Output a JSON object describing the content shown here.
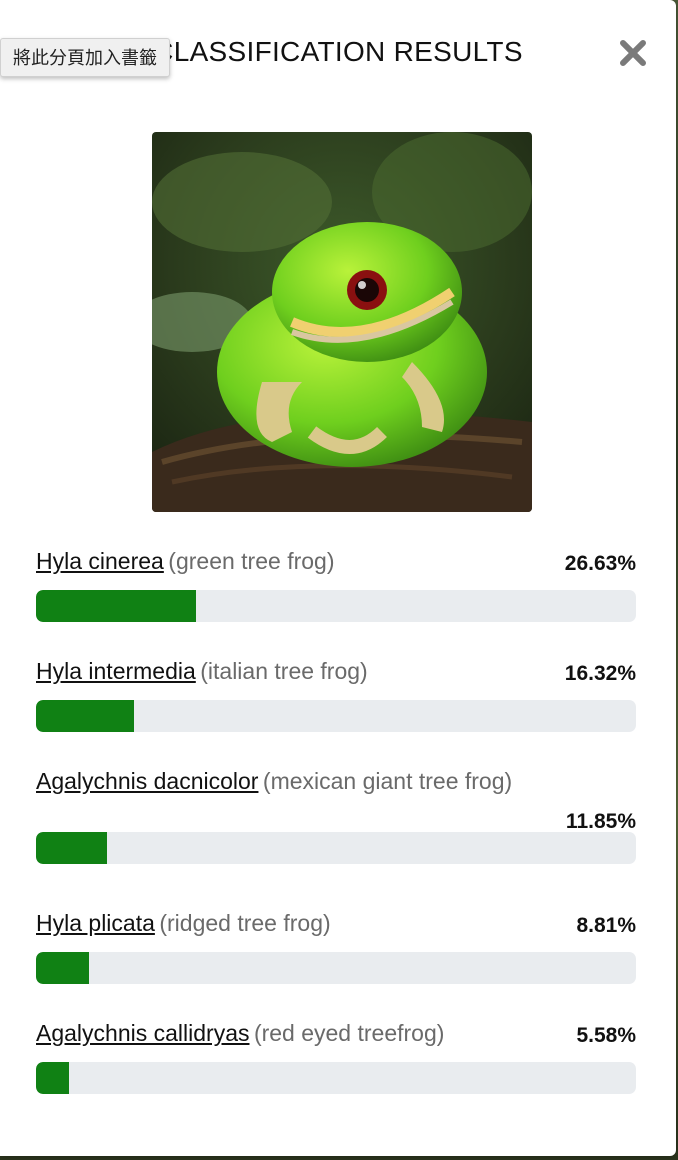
{
  "modal": {
    "title": "CLASSIFICATION RESULTS",
    "close_icon": "close-icon"
  },
  "tooltip": {
    "text": "將此分頁加入書籤"
  },
  "colors": {
    "bar_fill": "#108114",
    "bar_track": "#e9ecef",
    "common_name": "#6a6a6a"
  },
  "results": [
    {
      "species": "Hyla cinerea",
      "common": "(green tree frog)",
      "percent": "26.63%",
      "value": 26.63
    },
    {
      "species": "Hyla intermedia",
      "common": "(italian tree frog)",
      "percent": "16.32%",
      "value": 16.32
    },
    {
      "species": "Agalychnis dacnicolor",
      "common": "(mexican giant tree frog)",
      "percent": "11.85%",
      "value": 11.85
    },
    {
      "species": "Hyla plicata",
      "common": "(ridged tree frog)",
      "percent": "8.81%",
      "value": 8.81
    },
    {
      "species": "Agalychnis callidryas",
      "common": "(red eyed treefrog)",
      "percent": "5.58%",
      "value": 5.58
    }
  ]
}
